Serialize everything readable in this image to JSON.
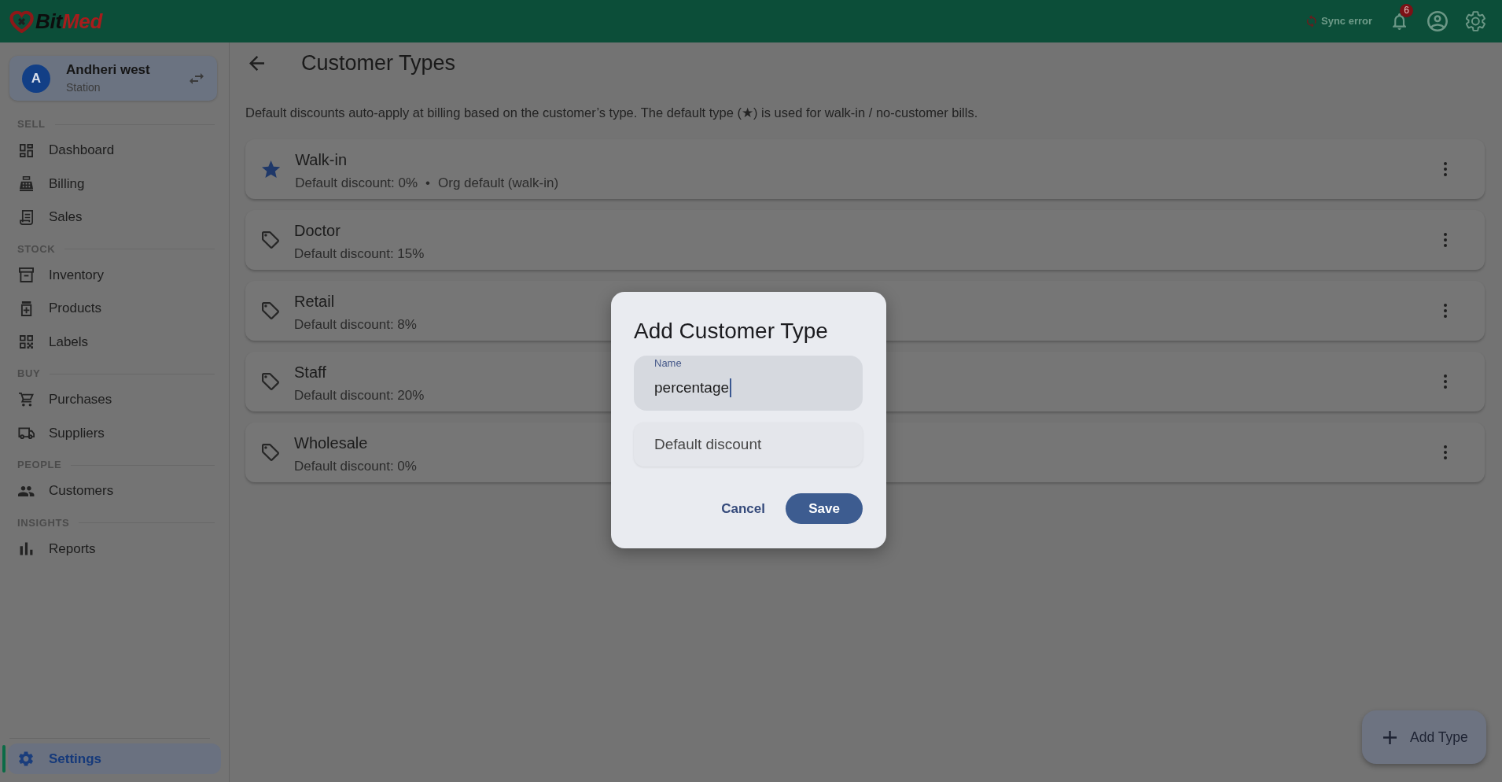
{
  "top_bar": {
    "logo": {
      "parts": [
        "Bit",
        "Med"
      ]
    },
    "sync_status": "Sync error",
    "notification_count": "6"
  },
  "sidebar": {
    "station": {
      "avatar": "A",
      "name": "Andheri west",
      "role": "Station"
    },
    "sections": [
      {
        "title": "SELL",
        "items": [
          {
            "label": "Dashboard",
            "selected": false
          },
          {
            "label": "Billing",
            "selected": false
          },
          {
            "label": "Sales",
            "selected": false
          }
        ]
      },
      {
        "title": "STOCK",
        "items": [
          {
            "label": "Inventory",
            "selected": false
          },
          {
            "label": "Products",
            "selected": false
          },
          {
            "label": "Labels",
            "selected": false
          }
        ]
      },
      {
        "title": "BUY",
        "items": [
          {
            "label": "Purchases",
            "selected": false
          },
          {
            "label": "Suppliers",
            "selected": false
          }
        ]
      },
      {
        "title": "PEOPLE",
        "items": [
          {
            "label": "Customers",
            "selected": false
          }
        ]
      },
      {
        "title": "INSIGHTS",
        "items": [
          {
            "label": "Reports",
            "selected": false
          }
        ]
      }
    ],
    "footer_items": [
      {
        "label": "Settings",
        "selected": true
      }
    ]
  },
  "page": {
    "title": "Customer Types",
    "description": "Default discounts auto-apply at billing based on the customer’s type. The default type (★) is used for walk-in / no-customer bills.",
    "types": [
      {
        "name": "Walk-in",
        "discount": "Default discount: 0%",
        "separator": "•",
        "note": "Org default (walk-in)",
        "default": true
      },
      {
        "name": "Doctor",
        "discount": "Default discount: 15%",
        "default": false
      },
      {
        "name": "Retail",
        "discount": "Default discount: 8%",
        "default": false
      },
      {
        "name": "Staff",
        "discount": "Default discount: 20%",
        "default": false
      },
      {
        "name": "Wholesale",
        "discount": "Default discount: 0%",
        "default": false
      }
    ],
    "add_button": {
      "label": "Add Type"
    }
  },
  "dialog": {
    "title": "Add Customer Type",
    "fields": [
      {
        "label": "Name",
        "value": "percentage",
        "focused": true
      },
      {
        "placeholder": "Default discount",
        "focused": false
      }
    ],
    "buttons": [
      {
        "label": "Cancel",
        "kind": "text"
      },
      {
        "label": "Save",
        "kind": "filled"
      }
    ]
  }
}
